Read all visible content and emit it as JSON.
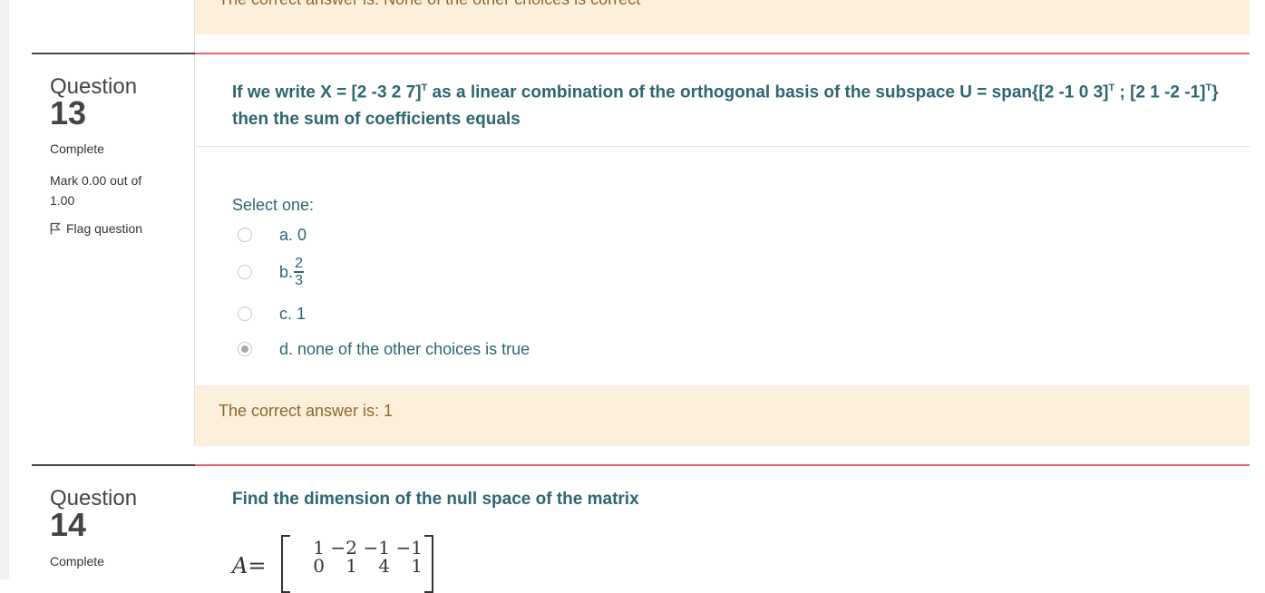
{
  "previous_feedback": "The correct answer is: None of the other choices is correct",
  "question13": {
    "label": "Question",
    "number": "13",
    "state": "Complete",
    "grade": "Mark 0.00 out of 1.00",
    "flag": "Flag question",
    "text_line1_a": "If we write X = [2 -3 2 7]",
    "text_line1_b": " as a linear combination of the orthogonal basis of the subspace U = span{[2 -1 0 3]",
    "text_line1_c": " ; [2 1 -2 -1]",
    "text_line1_d": "}",
    "text_line2": "then the sum of coefficients equals",
    "transpose": "T",
    "prompt": "Select one:",
    "options": {
      "a": "a. 0",
      "b_prefix": "b.",
      "b_num": "2",
      "b_den": "3",
      "c": "c. 1",
      "d": "d. none of the other choices is true"
    },
    "selected": "d",
    "feedback": "The correct answer is: 1"
  },
  "question14": {
    "label": "Question",
    "number": "14",
    "state": "Complete",
    "text": "Find the dimension of the null space of the matrix",
    "matrix_name": "A",
    "equals": "=",
    "matrix_row1": [
      "1",
      "−2",
      "−1",
      "−1"
    ],
    "matrix_row2": [
      "0",
      "1",
      "4",
      "1"
    ]
  }
}
